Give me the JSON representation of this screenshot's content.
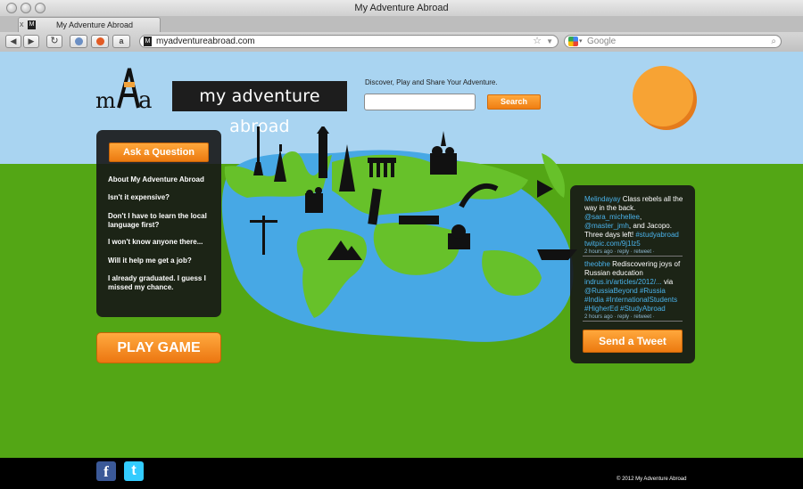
{
  "window": {
    "title": "My Adventure Abroad",
    "tab_label": "My Adventure Abroad",
    "tab_close": "x",
    "tab_favicon": "M",
    "url": "myadventureabroad.com",
    "search_placeholder": "Google"
  },
  "toolbar": {
    "back_icon": "◀",
    "forward_icon": "▶",
    "reload_icon": "↻",
    "amazon_icon": "a"
  },
  "header": {
    "logo_text": "mAa",
    "brand_name": "my adventure abroad",
    "tagline": "Discover, Play and Share Your Adventure.",
    "search_value": "",
    "search_button": "Search"
  },
  "left_panel": {
    "ask_button": "Ask a Question",
    "faq": [
      "About My Adventure Abroad",
      "Isn't it expensive?",
      "Don't I have to learn the local language first?",
      "I won't know anyone there...",
      "Will it help me get a job?",
      "I already graduated. I guess I missed my chance."
    ],
    "play_button": "PLAY GAME"
  },
  "tweets": [
    {
      "user": "Melindayay",
      "text": " Class rebels all the way in the back. ",
      "mention1": "@sara_michellee",
      "sep": ", ",
      "mention2": "@master_jmh",
      "text2": ", and Jacopo. Three days left! ",
      "hashtag": "#studyabroad",
      "link": "twitpic.com/9j1lz5",
      "meta": "2 hours ago · reply · retweet ·"
    },
    {
      "user": "theobhe",
      "text": " Rediscovering joys of Russian education ",
      "link": "indrus.in/articles/2012/...",
      "via": " via ",
      "mention": "@RussiaBeyond",
      "tags": "#Russia #India #InternationalStudents #HigherEd #StudyAbroad",
      "meta": "2 hours ago · reply · retweet ·"
    }
  ],
  "tweet_button": "Send a Tweet",
  "footer": {
    "facebook_icon": "f",
    "twitter_icon": "t",
    "copyright": "© 2012 My Adventure Abroad"
  },
  "colors": {
    "sky": "#a9d4f1",
    "grass": "#53a615",
    "water": "#47a8e5",
    "land": "#67c12a",
    "accent_orange": "#f28418",
    "panel": "#161616",
    "twitter_link": "#4ab2ea"
  }
}
